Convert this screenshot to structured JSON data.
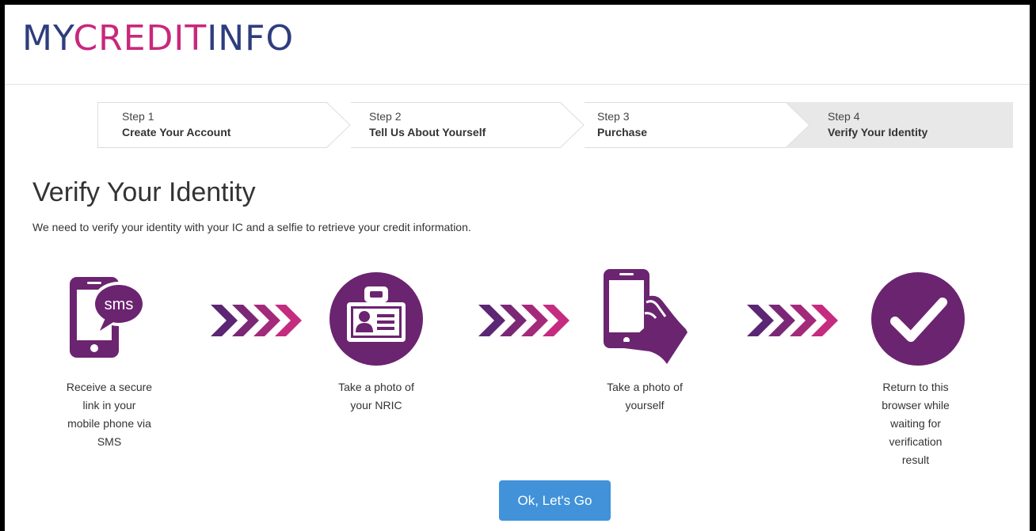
{
  "brand": {
    "part1": "MY",
    "part2": "CREDIT",
    "part3": "INFO"
  },
  "colors": {
    "brand_navy": "#2f3d7e",
    "brand_magenta": "#c8287c",
    "icon_purple": "#6b2470",
    "button_blue": "#4192d9"
  },
  "steps": [
    {
      "number": "Step 1",
      "title": "Create Your Account",
      "active": false
    },
    {
      "number": "Step 2",
      "title": "Tell Us About Yourself",
      "active": false
    },
    {
      "number": "Step 3",
      "title": "Purchase",
      "active": false
    },
    {
      "number": "Step 4",
      "title": "Verify Your Identity",
      "active": true
    }
  ],
  "main": {
    "title": "Verify Your Identity",
    "subtitle": "We need to verify your identity with your IC and a selfie to retrieve your credit information."
  },
  "process": [
    {
      "icon": "sms-phone-icon",
      "sms_text": "sms",
      "lines": [
        "Receive a secure",
        "link in your",
        "mobile phone via",
        "SMS"
      ]
    },
    {
      "icon": "id-card-icon",
      "lines": [
        "Take a photo of",
        "your NRIC"
      ]
    },
    {
      "icon": "phone-in-hand-icon",
      "lines": [
        "Take a photo of",
        "yourself"
      ]
    },
    {
      "icon": "checkmark-circle-icon",
      "lines": [
        "Return to this",
        "browser while",
        "waiting for",
        "verification",
        "result"
      ]
    }
  ],
  "cta": {
    "label": "Ok, Let's Go"
  }
}
